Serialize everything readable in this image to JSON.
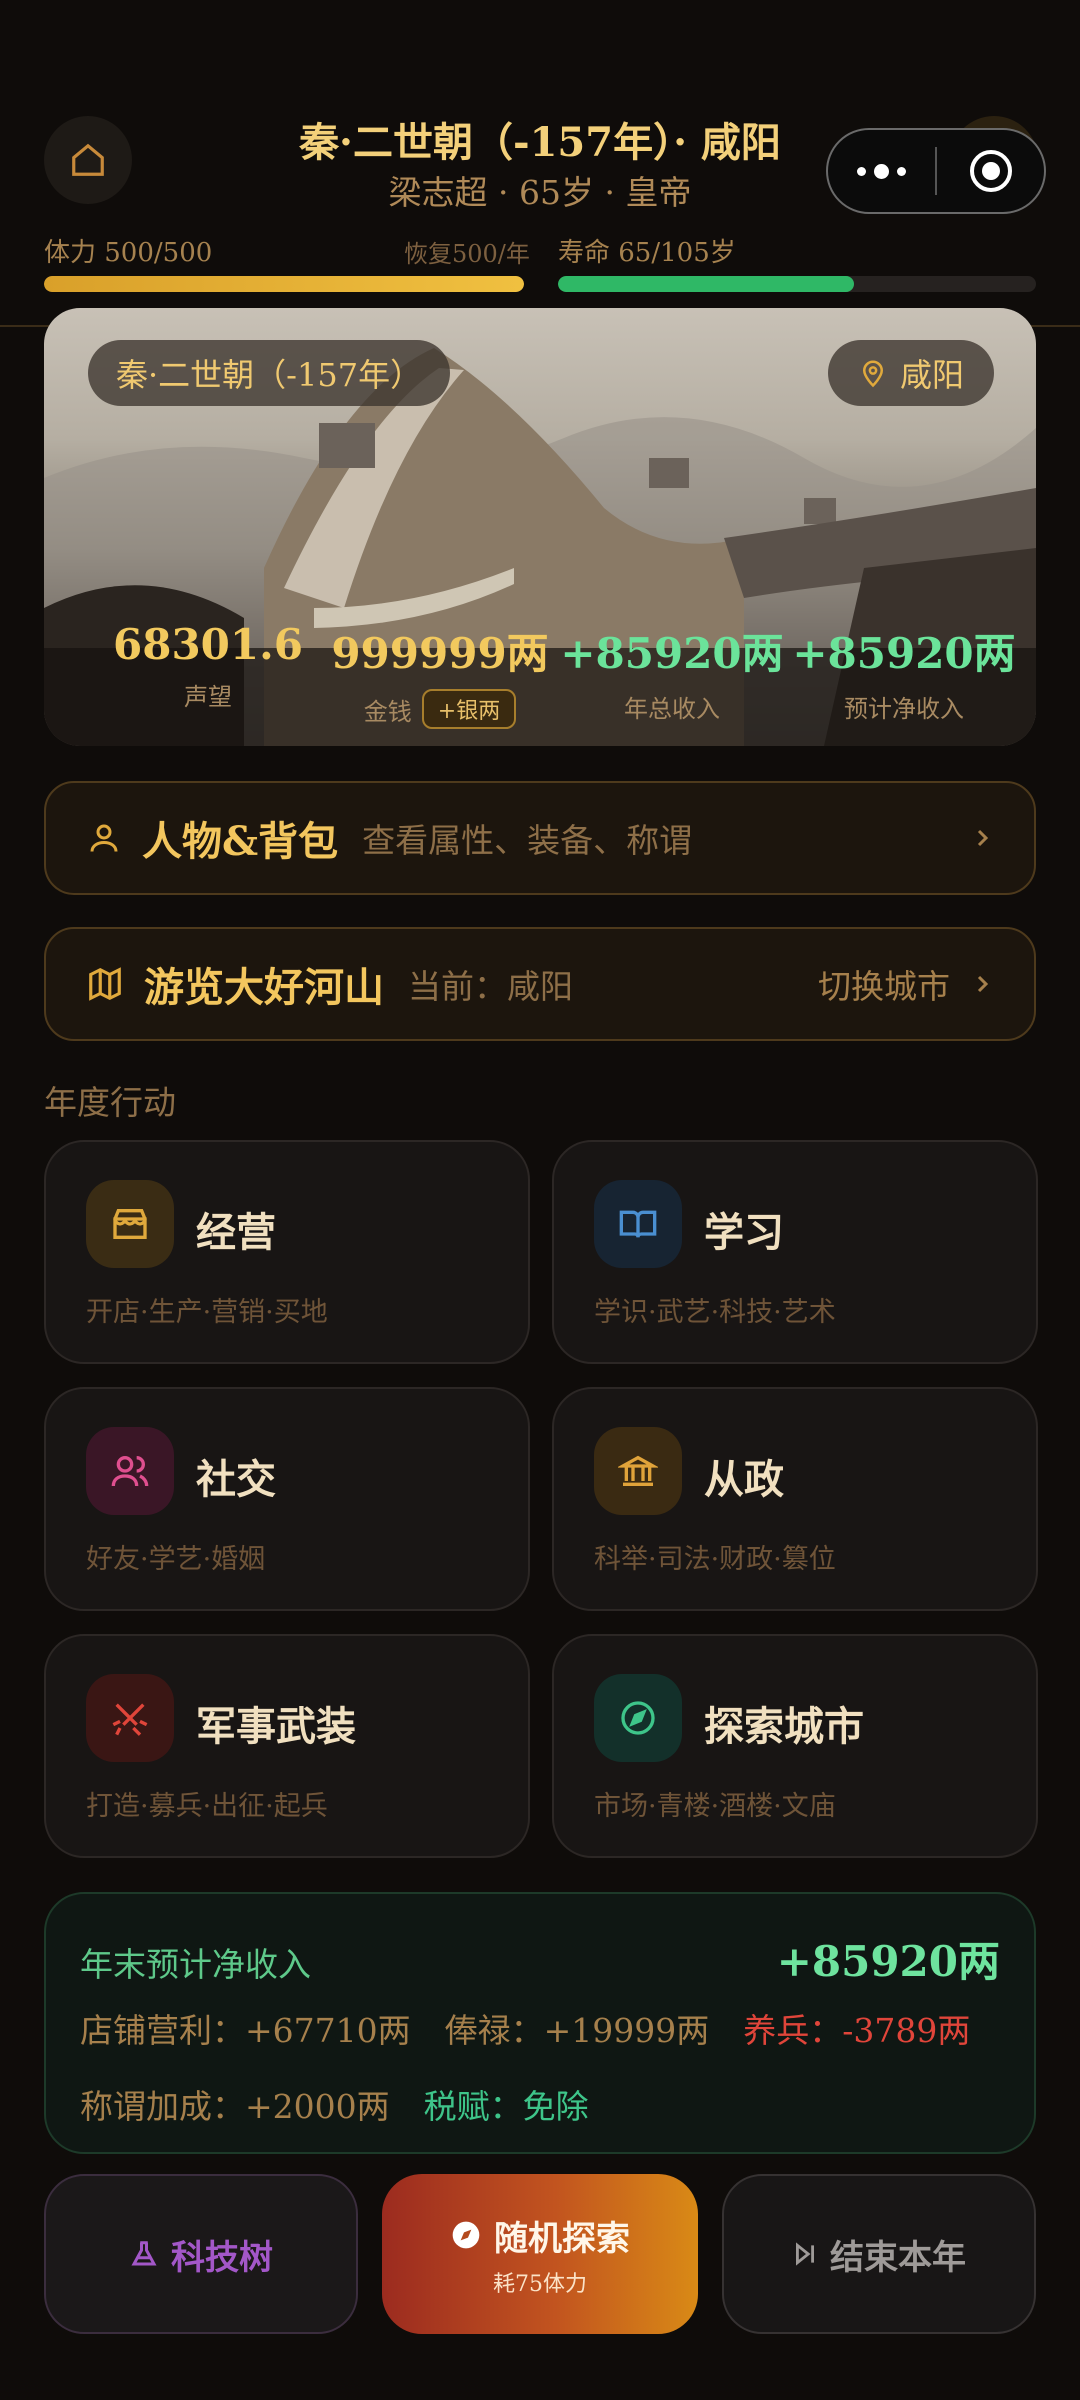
{
  "header": {
    "title": "秦·二世朝（-157年）· 咸阳",
    "subtitle": "梁志超 · 65岁 · 皇帝"
  },
  "stats": {
    "stamina_label": "体力 500/500",
    "stamina_recover": "恢复500/年",
    "stamina_fraction": 1.0,
    "lifespan_label": "寿命 65/105岁",
    "lifespan_fraction": 0.62
  },
  "hero": {
    "era_pill": "秦·二世朝（-157年）",
    "city_pill": "咸阳",
    "stats": [
      {
        "value": "68301.6",
        "label": "声望",
        "color": "#f2c95e"
      },
      {
        "value": "999999两",
        "label": "金钱",
        "color": "#f2c95e",
        "button": "+银两"
      },
      {
        "value": "+85920两",
        "label": "年总收入",
        "color": "#6be39a"
      },
      {
        "value": "+85920两",
        "label": "预计净收入",
        "color": "#6be39a"
      }
    ]
  },
  "character_card": {
    "title": "人物&背包",
    "desc": "查看属性、装备、称谓"
  },
  "travel_card": {
    "title": "游览大好河山",
    "desc": "当前：咸阳",
    "action": "切换城市"
  },
  "actions_title": "年度行动",
  "actions": [
    {
      "name": "经营",
      "sub": "开店·生产·营销·买地",
      "icon": "shop-icon",
      "bg": "#3a2c14",
      "color": "#e0a93c"
    },
    {
      "name": "学习",
      "sub": "学识·武艺·科技·艺术",
      "icon": "book-icon",
      "bg": "#172432",
      "color": "#4a8fd1"
    },
    {
      "name": "社交",
      "sub": "好友·学艺·婚姻",
      "icon": "users-icon",
      "bg": "#3a1626",
      "color": "#df4f8f"
    },
    {
      "name": "从政",
      "sub": "科举·司法·财政·篡位",
      "icon": "government-icon",
      "bg": "#3a2a12",
      "color": "#e0a33a"
    },
    {
      "name": "军事武装",
      "sub": "打造·募兵·出征·起兵",
      "icon": "swords-icon",
      "bg": "#3a1614",
      "color": "#e0453a"
    },
    {
      "name": "探索城市",
      "sub": "市场·青楼·酒楼·文庙",
      "icon": "compass-icon",
      "bg": "#13302a",
      "color": "#3ec58a"
    }
  ],
  "summary": {
    "label": "年末预计净收入",
    "total": "+85920两",
    "row1": [
      {
        "key": "店铺营利：",
        "val": "+67710两",
        "color": "#a6804c"
      },
      {
        "key": "俸禄：",
        "val": "+19999两",
        "color": "#a6804c"
      },
      {
        "key": "养兵：",
        "val": "-3789两",
        "color": "#e0453a"
      }
    ],
    "row2": [
      {
        "key": "称谓加成：",
        "val": "+2000两",
        "color": "#a6804c"
      },
      {
        "key": "税赋：",
        "val": "免除",
        "color": "#3ec58a"
      }
    ]
  },
  "bottom": {
    "tech": "科技树",
    "explore": "随机探索",
    "explore_cost": "耗75体力",
    "end_year": "结束本年"
  }
}
